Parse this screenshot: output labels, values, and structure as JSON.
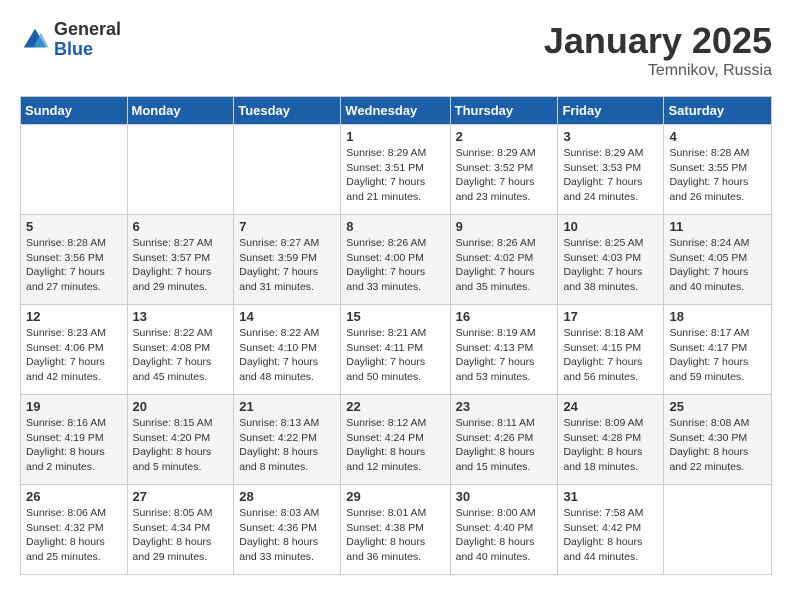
{
  "logo": {
    "general": "General",
    "blue": "Blue"
  },
  "title": "January 2025",
  "location": "Temnikov, Russia",
  "weekdays": [
    "Sunday",
    "Monday",
    "Tuesday",
    "Wednesday",
    "Thursday",
    "Friday",
    "Saturday"
  ],
  "weeks": [
    [
      {
        "day": "",
        "info": ""
      },
      {
        "day": "",
        "info": ""
      },
      {
        "day": "",
        "info": ""
      },
      {
        "day": "1",
        "info": "Sunrise: 8:29 AM\nSunset: 3:51 PM\nDaylight: 7 hours and 21 minutes."
      },
      {
        "day": "2",
        "info": "Sunrise: 8:29 AM\nSunset: 3:52 PM\nDaylight: 7 hours and 23 minutes."
      },
      {
        "day": "3",
        "info": "Sunrise: 8:29 AM\nSunset: 3:53 PM\nDaylight: 7 hours and 24 minutes."
      },
      {
        "day": "4",
        "info": "Sunrise: 8:28 AM\nSunset: 3:55 PM\nDaylight: 7 hours and 26 minutes."
      }
    ],
    [
      {
        "day": "5",
        "info": "Sunrise: 8:28 AM\nSunset: 3:56 PM\nDaylight: 7 hours and 27 minutes."
      },
      {
        "day": "6",
        "info": "Sunrise: 8:27 AM\nSunset: 3:57 PM\nDaylight: 7 hours and 29 minutes."
      },
      {
        "day": "7",
        "info": "Sunrise: 8:27 AM\nSunset: 3:59 PM\nDaylight: 7 hours and 31 minutes."
      },
      {
        "day": "8",
        "info": "Sunrise: 8:26 AM\nSunset: 4:00 PM\nDaylight: 7 hours and 33 minutes."
      },
      {
        "day": "9",
        "info": "Sunrise: 8:26 AM\nSunset: 4:02 PM\nDaylight: 7 hours and 35 minutes."
      },
      {
        "day": "10",
        "info": "Sunrise: 8:25 AM\nSunset: 4:03 PM\nDaylight: 7 hours and 38 minutes."
      },
      {
        "day": "11",
        "info": "Sunrise: 8:24 AM\nSunset: 4:05 PM\nDaylight: 7 hours and 40 minutes."
      }
    ],
    [
      {
        "day": "12",
        "info": "Sunrise: 8:23 AM\nSunset: 4:06 PM\nDaylight: 7 hours and 42 minutes."
      },
      {
        "day": "13",
        "info": "Sunrise: 8:22 AM\nSunset: 4:08 PM\nDaylight: 7 hours and 45 minutes."
      },
      {
        "day": "14",
        "info": "Sunrise: 8:22 AM\nSunset: 4:10 PM\nDaylight: 7 hours and 48 minutes."
      },
      {
        "day": "15",
        "info": "Sunrise: 8:21 AM\nSunset: 4:11 PM\nDaylight: 7 hours and 50 minutes."
      },
      {
        "day": "16",
        "info": "Sunrise: 8:19 AM\nSunset: 4:13 PM\nDaylight: 7 hours and 53 minutes."
      },
      {
        "day": "17",
        "info": "Sunrise: 8:18 AM\nSunset: 4:15 PM\nDaylight: 7 hours and 56 minutes."
      },
      {
        "day": "18",
        "info": "Sunrise: 8:17 AM\nSunset: 4:17 PM\nDaylight: 7 hours and 59 minutes."
      }
    ],
    [
      {
        "day": "19",
        "info": "Sunrise: 8:16 AM\nSunset: 4:19 PM\nDaylight: 8 hours and 2 minutes."
      },
      {
        "day": "20",
        "info": "Sunrise: 8:15 AM\nSunset: 4:20 PM\nDaylight: 8 hours and 5 minutes."
      },
      {
        "day": "21",
        "info": "Sunrise: 8:13 AM\nSunset: 4:22 PM\nDaylight: 8 hours and 8 minutes."
      },
      {
        "day": "22",
        "info": "Sunrise: 8:12 AM\nSunset: 4:24 PM\nDaylight: 8 hours and 12 minutes."
      },
      {
        "day": "23",
        "info": "Sunrise: 8:11 AM\nSunset: 4:26 PM\nDaylight: 8 hours and 15 minutes."
      },
      {
        "day": "24",
        "info": "Sunrise: 8:09 AM\nSunset: 4:28 PM\nDaylight: 8 hours and 18 minutes."
      },
      {
        "day": "25",
        "info": "Sunrise: 8:08 AM\nSunset: 4:30 PM\nDaylight: 8 hours and 22 minutes."
      }
    ],
    [
      {
        "day": "26",
        "info": "Sunrise: 8:06 AM\nSunset: 4:32 PM\nDaylight: 8 hours and 25 minutes."
      },
      {
        "day": "27",
        "info": "Sunrise: 8:05 AM\nSunset: 4:34 PM\nDaylight: 8 hours and 29 minutes."
      },
      {
        "day": "28",
        "info": "Sunrise: 8:03 AM\nSunset: 4:36 PM\nDaylight: 8 hours and 33 minutes."
      },
      {
        "day": "29",
        "info": "Sunrise: 8:01 AM\nSunset: 4:38 PM\nDaylight: 8 hours and 36 minutes."
      },
      {
        "day": "30",
        "info": "Sunrise: 8:00 AM\nSunset: 4:40 PM\nDaylight: 8 hours and 40 minutes."
      },
      {
        "day": "31",
        "info": "Sunrise: 7:58 AM\nSunset: 4:42 PM\nDaylight: 8 hours and 44 minutes."
      },
      {
        "day": "",
        "info": ""
      }
    ]
  ]
}
